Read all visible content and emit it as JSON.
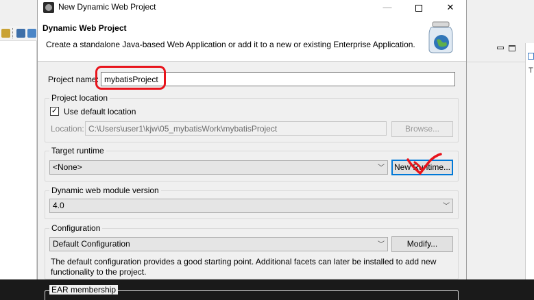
{
  "window": {
    "title": "New Dynamic Web Project",
    "min_glyph": "—",
    "close_glyph": "✕"
  },
  "banner": {
    "title": "Dynamic Web Project",
    "description": "Create a standalone Java-based Web Application or add it to a new or existing Enterprise Application."
  },
  "project_name": {
    "label": "Project name:",
    "value": "mybatisProject"
  },
  "project_location": {
    "group_title": "Project location",
    "use_default_label": "Use default location",
    "use_default_checked": true,
    "check_glyph": "✓",
    "location_label": "Location:",
    "location_value": "C:\\Users\\user1\\kjw\\05_mybatisWork\\mybatisProject",
    "browse_label": "Browse..."
  },
  "target_runtime": {
    "group_title": "Target runtime",
    "selected": "<None>",
    "new_runtime_label": "New Runtime..."
  },
  "web_module": {
    "group_title": "Dynamic web module version",
    "selected": "4.0"
  },
  "configuration": {
    "group_title": "Configuration",
    "selected": "Default Configuration",
    "modify_label": "Modify...",
    "note": "The default configuration provides a good starting point. Additional facets can later be installed to add new functionality to the project."
  },
  "ear": {
    "group_title": "EAR membership"
  },
  "ide": {
    "right_pane_letter": "T"
  },
  "icons": {
    "combo_arrow": "chevron-down-icon",
    "check": "check-icon",
    "jar": "web-project-jar-icon"
  },
  "colors": {
    "annotation_red": "#e8141c",
    "focus_blue": "#0078d7"
  }
}
